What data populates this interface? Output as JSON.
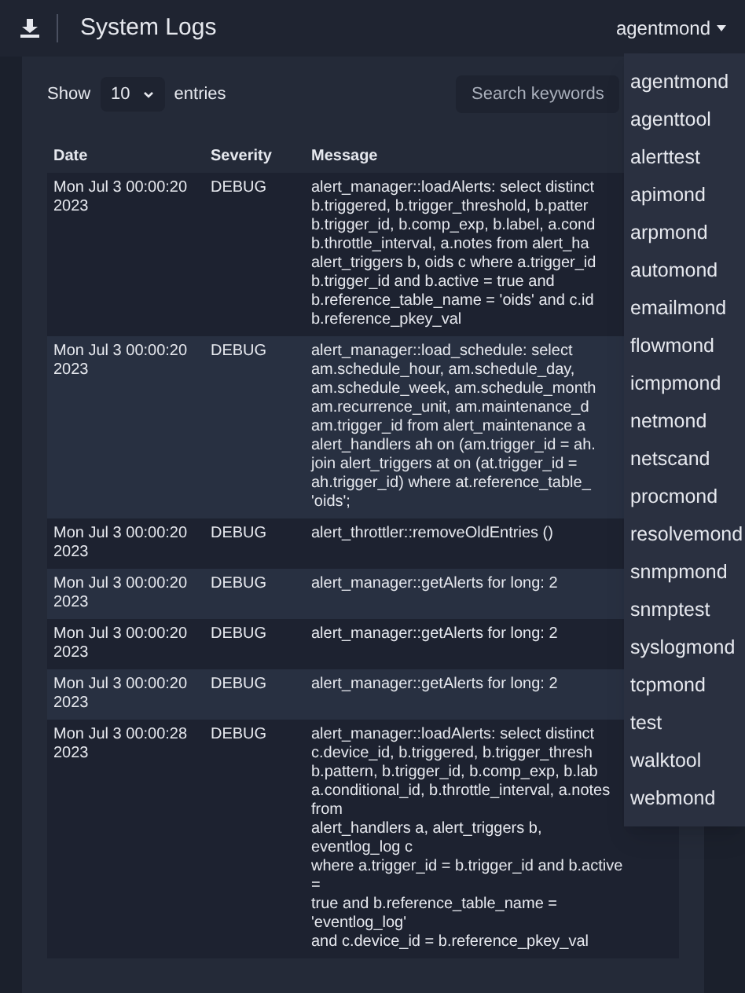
{
  "header": {
    "title": "System Logs",
    "user_menu": "agentmond"
  },
  "controls": {
    "show_label": "Show",
    "page_size": "10",
    "entries_label": "entries",
    "search": {
      "placeholder": "Search keywords"
    }
  },
  "table": {
    "columns": [
      "Date",
      "Severity",
      "Message"
    ],
    "rows": [
      {
        "date": "Mon Jul 3 00:00:20 2023",
        "severity": "DEBUG",
        "message": [
          "alert_manager::loadAlerts: select distinct",
          "b.triggered, b.trigger_threshold, b.patter",
          "b.trigger_id, b.comp_exp, b.label, a.cond",
          "b.throttle_interval, a.notes from alert_ha",
          "alert_triggers b, oids c where a.trigger_id",
          "b.trigger_id and b.active = true and",
          "b.reference_table_name = 'oids' and c.id",
          "b.reference_pkey_val"
        ]
      },
      {
        "date": "Mon Jul 3 00:00:20 2023",
        "severity": "DEBUG",
        "message": [
          "alert_manager::load_schedule: select",
          "am.schedule_hour, am.schedule_day,",
          "am.schedule_week, am.schedule_month",
          "am.recurrence_unit, am.maintenance_d",
          "am.trigger_id from alert_maintenance a",
          "alert_handlers ah on (am.trigger_id = ah.",
          "join alert_triggers at on (at.trigger_id =",
          "ah.trigger_id) where at.reference_table_",
          "'oids';"
        ]
      },
      {
        "date": "Mon Jul 3 00:00:20 2023",
        "severity": "DEBUG",
        "message": [
          "alert_throttler::removeOldEntries ()"
        ]
      },
      {
        "date": "Mon Jul 3 00:00:20 2023",
        "severity": "DEBUG",
        "message": [
          "alert_manager::getAlerts for long: 2"
        ]
      },
      {
        "date": "Mon Jul 3 00:00:20 2023",
        "severity": "DEBUG",
        "message": [
          "alert_manager::getAlerts for long: 2"
        ]
      },
      {
        "date": "Mon Jul 3 00:00:20 2023",
        "severity": "DEBUG",
        "message": [
          "alert_manager::getAlerts for long: 2"
        ]
      },
      {
        "date": "Mon Jul 3 00:00:28 2023",
        "severity": "DEBUG",
        "message": [
          "alert_manager::loadAlerts: select distinct",
          "c.device_id, b.triggered, b.trigger_thresh",
          "b.pattern, b.trigger_id, b.comp_exp, b.lab",
          "a.conditional_id, b.throttle_interval, a.notes from",
          "alert_handlers a, alert_triggers b, eventlog_log c",
          "where a.trigger_id = b.trigger_id and b.active =",
          "true and b.reference_table_name = 'eventlog_log'",
          "and c.device_id = b.reference_pkey_val"
        ]
      }
    ]
  },
  "dropdown": {
    "items": [
      "agentmond",
      "agenttool",
      "alerttest",
      "apimond",
      "arpmond",
      "automond",
      "emailmond",
      "flowmond",
      "icmpmond",
      "netmond",
      "netscand",
      "procmond",
      "resolvemond",
      "snmpmond",
      "snmptest",
      "syslogmond",
      "tcpmond",
      "test",
      "walktool",
      "webmond"
    ]
  }
}
